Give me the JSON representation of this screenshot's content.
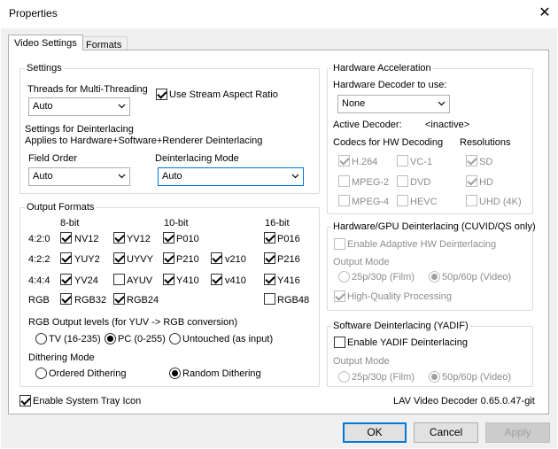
{
  "window": {
    "title": "Properties",
    "close_glyph": "✕"
  },
  "tabs": [
    "Video Settings",
    "Formats"
  ],
  "settings": {
    "group_label": "Settings",
    "threads_label": "Threads for Multi-Threading",
    "threads_value": "Auto",
    "aspect_label": "Use Stream Aspect Ratio",
    "deint_label_1": "Settings for Deinterlacing",
    "deint_label_2": "Applies to Hardware+Software+Renderer Deinterlacing",
    "field_order_label": "Field Order",
    "field_order_value": "Auto",
    "deint_mode_label": "Deinterlacing Mode",
    "deint_mode_value": "Auto"
  },
  "output_formats": {
    "group_label": "Output Formats",
    "headers": [
      "8-bit",
      "10-bit",
      "16-bit"
    ],
    "rows": [
      "4:2:0",
      "4:2:2",
      "4:4:4",
      "RGB"
    ],
    "formats": {
      "nv12": "NV12",
      "yv12": "YV12",
      "p010": "P010",
      "p016": "P016",
      "yuy2": "YUY2",
      "uyvy": "UYVY",
      "p210": "P210",
      "v210": "v210",
      "p216": "P216",
      "yv24": "YV24",
      "ayuv": "AYUV",
      "y410": "Y410",
      "v410": "v410",
      "y416": "Y416",
      "rgb32": "RGB32",
      "rgb24": "RGB24",
      "rgb48": "RGB48"
    },
    "levels_label": "RGB Output levels (for YUV -> RGB conversion)",
    "levels": [
      "TV (16-235)",
      "PC (0-255)",
      "Untouched (as input)"
    ],
    "dither_label": "Dithering Mode",
    "dither": [
      "Ordered Dithering",
      "Random Dithering"
    ]
  },
  "hw_accel": {
    "group_label": "Hardware Acceleration",
    "decoder_label": "Hardware Decoder to use:",
    "decoder_value": "None",
    "active_label": "Active Decoder:",
    "active_value": "<inactive>",
    "codecs_label": "Codecs for HW Decoding",
    "resolutions_label": "Resolutions",
    "codecs": {
      "h264": "H.264",
      "vc1": "VC-1",
      "mpeg2": "MPEG-2",
      "dvd": "DVD",
      "mpeg4": "MPEG-4",
      "hevc": "HEVC"
    },
    "res": {
      "sd": "SD",
      "hd": "HD",
      "uhd": "UHD (4K)"
    }
  },
  "hw_deint": {
    "group_label": "Hardware/GPU Deinterlacing (CUVID/QS only)",
    "adaptive_label": "Enable Adaptive HW Deinterlacing",
    "output_mode_label": "Output Mode",
    "modes": [
      "25p/30p (Film)",
      "50p/60p (Video)"
    ],
    "hq_label": "High-Quality Processing"
  },
  "sw_deint": {
    "group_label": "Software Deinterlacing (YADIF)",
    "enable_label": "Enable YADIF Deinterlacing",
    "output_mode_label": "Output Mode",
    "modes": [
      "25p/30p (Film)",
      "50p/60p (Video)"
    ]
  },
  "footer": {
    "tray_label": "Enable System Tray Icon",
    "version": "LAV Video Decoder 0.65.0.47-git",
    "ok": "OK",
    "cancel": "Cancel",
    "apply": "Apply"
  },
  "colors": {
    "accent": "#0078d7",
    "disabled_text": "#8c8c8c",
    "client_bg": "#f0f0f0"
  }
}
